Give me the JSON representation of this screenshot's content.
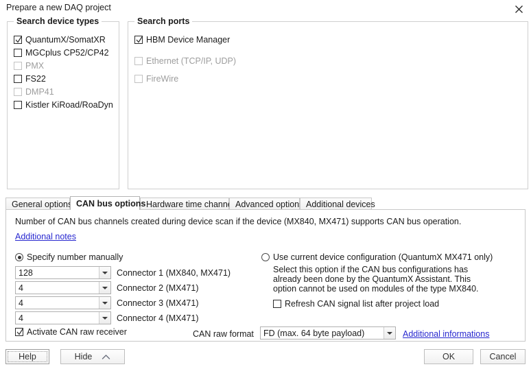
{
  "window": {
    "title": "Prepare a new DAQ project",
    "close_icon": "close-icon"
  },
  "device_types_group": {
    "title": "Search device types",
    "items": [
      {
        "label": "QuantumX/SomatXR",
        "checked": true,
        "disabled": false
      },
      {
        "label": "MGCplus CP52/CP42",
        "checked": false,
        "disabled": false
      },
      {
        "label": "PMX",
        "checked": false,
        "disabled": true
      },
      {
        "label": "FS22",
        "checked": false,
        "disabled": false
      },
      {
        "label": "DMP41",
        "checked": false,
        "disabled": true
      },
      {
        "label": "Kistler KiRoad/RoaDyn",
        "checked": false,
        "disabled": false
      }
    ]
  },
  "ports_group": {
    "title": "Search ports",
    "items": [
      {
        "label": "HBM Device Manager",
        "checked": true,
        "disabled": false
      },
      {
        "label": "Ethernet (TCP/IP, UDP)",
        "checked": false,
        "disabled": true
      },
      {
        "label": "FireWire",
        "checked": false,
        "disabled": true
      }
    ]
  },
  "tabs": [
    {
      "label": "General options",
      "active": false
    },
    {
      "label": "CAN bus options",
      "active": true
    },
    {
      "label": "Hardware time channels",
      "active": false
    },
    {
      "label": "Advanced options",
      "active": false
    },
    {
      "label": "Additional devices",
      "active": false
    }
  ],
  "can_tab": {
    "description": "Number of CAN bus channels created during device scan if the device (MX840, MX471) supports CAN bus operation.",
    "additional_notes_link": "Additional notes",
    "mode_manual": {
      "label": "Specify number manually",
      "selected": true
    },
    "mode_current": {
      "label": "Use current device configuration (QuantumX MX471 only)",
      "selected": false,
      "hint": "Select this option if the CAN bus configurations has already been done by the QuantumX Assistant. This option cannot be used on modules of the type MX840.",
      "refresh_checkbox": {
        "label": "Refresh CAN signal list after project load",
        "checked": false
      }
    },
    "connectors": [
      {
        "value": "128",
        "label": "Connector 1 (MX840, MX471)"
      },
      {
        "value": "4",
        "label": "Connector 2 (MX471)"
      },
      {
        "value": "4",
        "label": "Connector 3 (MX471)"
      },
      {
        "value": "4",
        "label": "Connector 4 (MX471)"
      }
    ],
    "activate_raw_receiver": {
      "label": "Activate CAN raw receiver",
      "checked": true
    },
    "raw_format": {
      "label": "CAN raw format",
      "value": "FD (max. 64 byte payload)"
    },
    "additional_informations_link": "Additional informations"
  },
  "footer": {
    "help": "Help",
    "hide": "Hide",
    "hide_icon": "chevron-up-icon",
    "ok": "OK",
    "cancel": "Cancel"
  },
  "colors": {
    "link": "#2727cf",
    "border": "#cfcfcf",
    "text": "#1b1b1b",
    "disabled_text": "#9d9d9d"
  }
}
